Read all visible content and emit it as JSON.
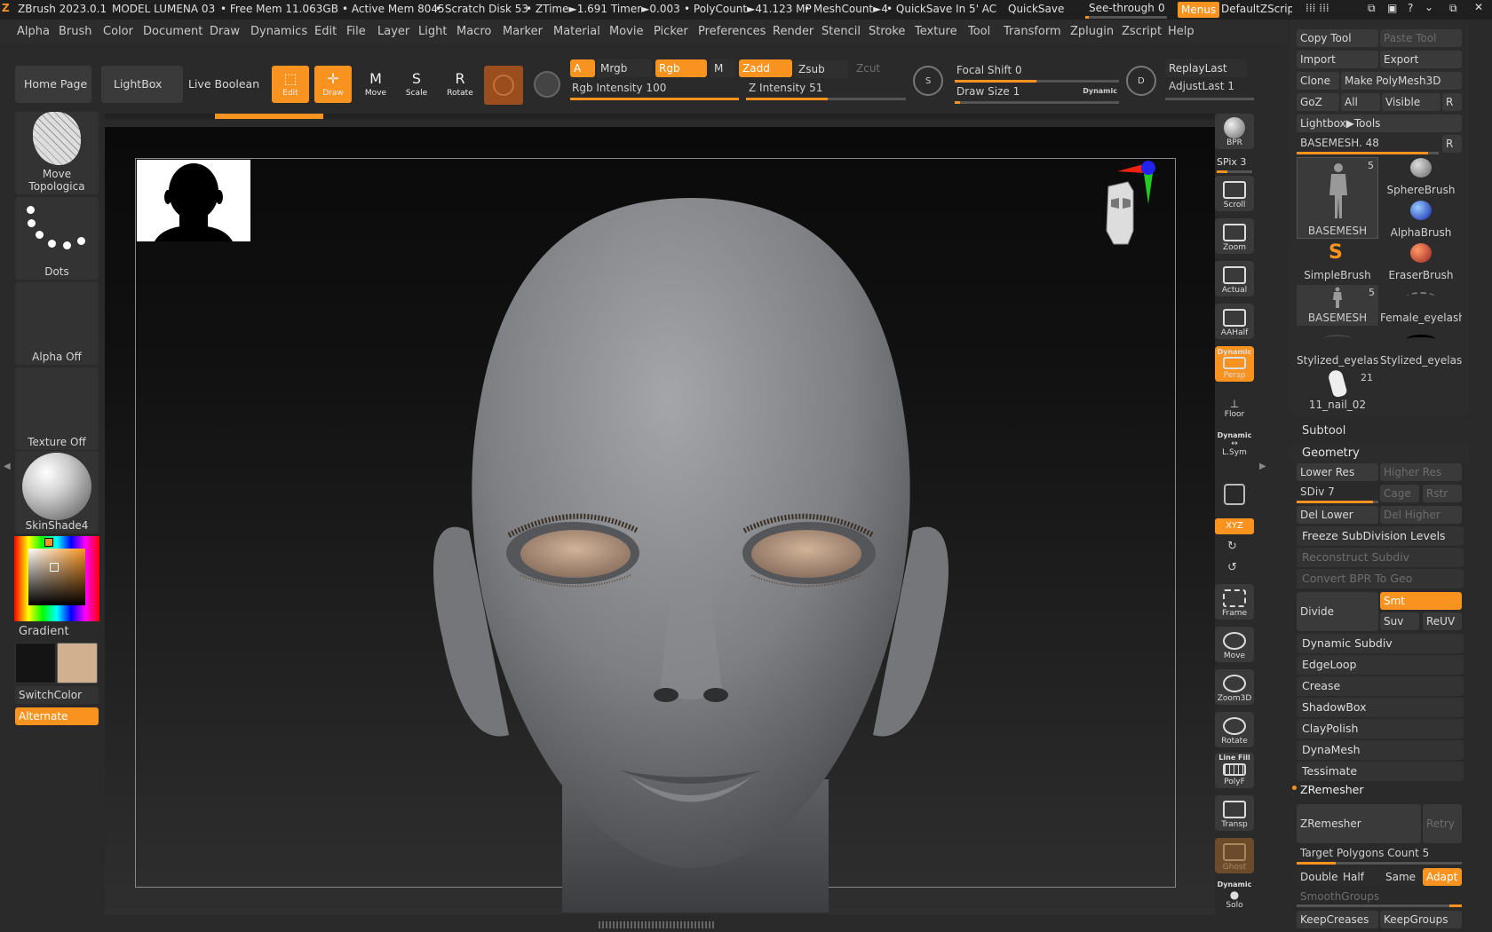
{
  "titlebar": {
    "app": "ZBrush 2023.0.1",
    "model": "MODEL LUMENA 03",
    "free_mem": "• Free Mem 11.063GB",
    "active_mem": "• Active Mem 8045",
    "scratch": "• Scratch Disk 53",
    "ztime": "• ZTime►1.691 Timer►0.003",
    "polycount": "• PolyCount►41.123 MP",
    "meshcount": "• MeshCount►4",
    "quicksave_in": "• QuickSave In 5' AC",
    "quicksave": "QuickSave",
    "seethrough": "See-through",
    "seethrough_val": "0",
    "menus": "Menus",
    "script": "DefaultZScript"
  },
  "menu": [
    "Alpha",
    "Brush",
    "Color",
    "Document",
    "Draw",
    "Dynamics",
    "Edit",
    "File",
    "Layer",
    "Light",
    "Macro",
    "Marker",
    "Material",
    "Movie",
    "Picker",
    "Preferences",
    "Render",
    "Stencil",
    "Stroke",
    "Texture",
    "Tool",
    "Transform",
    "Zplugin",
    "Zscript",
    "Help"
  ],
  "toolbar": {
    "home": "Home Page",
    "lightbox": "LightBox",
    "live_boolean": "Live Boolean",
    "edit": "Edit",
    "draw": "Draw",
    "move": "Move",
    "scale": "Scale",
    "rotate": "Rotate",
    "a": "A",
    "mrgb": "Mrgb",
    "rgb": "Rgb",
    "m": "M",
    "zadd": "Zadd",
    "zsub": "Zsub",
    "zcut": "Zcut",
    "rgb_intensity": "Rgb Intensity 100",
    "z_intensity": "Z Intensity 51",
    "focal_shift": "Focal Shift 0",
    "draw_size": "Draw Size 1",
    "dynamic": "Dynamic",
    "replay_last": "ReplayLast",
    "adjust_last": "AdjustLast 1",
    "rgb_intensity_val": 1.0,
    "z_intensity_val": 0.51
  },
  "left": {
    "brush": "Move Topologica",
    "stroke": "Dots",
    "alpha": "Alpha Off",
    "texture": "Texture Off",
    "material": "SkinShade4",
    "gradient": "Gradient",
    "switch_color": "SwitchColor",
    "alternate": "Alternate",
    "colors": {
      "primary": "#141414",
      "secondary": "#d0b08f",
      "accent": "#f7931e"
    }
  },
  "right_tools": {
    "bpr": "BPR",
    "spix": "SPix 3",
    "scroll": "Scroll",
    "zoom": "Zoom",
    "actual": "Actual",
    "aahalf": "AAHalf",
    "dynamic": "Dynamic",
    "persp": "Persp",
    "floor": "Floor",
    "lsym_dyn": "Dynamic",
    "lsym": "L.Sym",
    "xyz": "XYZ",
    "frame": "Frame",
    "move": "Move",
    "zoom3d": "Zoom3D",
    "rotate": "Rotate",
    "line_fill": "Line Fill",
    "polyf": "PolyF",
    "transp": "Transp",
    "ghost": "Ghost",
    "solo_dyn": "Dynamic",
    "solo": "Solo"
  },
  "tool_panel": {
    "copy_tool": "Copy Tool",
    "paste_tool": "Paste Tool",
    "import": "Import",
    "export": "Export",
    "clone": "Clone",
    "make_polymesh": "Make PolyMesh3D",
    "goz": "GoZ",
    "all": "All",
    "visible": "Visible",
    "r": "R",
    "lightbox_tools": "Lightbox▶Tools",
    "basemesh_slider": "BASEMESH. 48",
    "r2": "R",
    "thumbs": [
      {
        "label": "BASEMESH",
        "badge": "5"
      },
      {
        "label": "SphereBrush",
        "badge": ""
      },
      {
        "label": "AlphaBrush",
        "badge": ""
      },
      {
        "label": "SimpleBrush",
        "badge": ""
      },
      {
        "label": "EraserBrush",
        "badge": ""
      },
      {
        "label": "BASEMESH",
        "badge": "5"
      },
      {
        "label": "Female_eyelashe",
        "badge": ""
      },
      {
        "label": "Stylized_eyelash",
        "badge": ""
      },
      {
        "label": "Stylized_eyelash",
        "badge": ""
      },
      {
        "label": "11_nail_02",
        "badge": "21"
      }
    ]
  },
  "subtool": {
    "title": "Subtool",
    "geometry": "Geometry",
    "lower_res": "Lower Res",
    "higher_res": "Higher Res",
    "sdiv": "SDiv 7",
    "cage": "Cage",
    "rstr": "Rstr",
    "del_lower": "Del Lower",
    "del_higher": "Del Higher",
    "freeze": "Freeze SubDivision Levels",
    "reconstruct": "Reconstruct Subdiv",
    "convert_bpr": "Convert BPR To Geo",
    "divide": "Divide",
    "smt": "Smt",
    "suv": "Suv",
    "reuv": "ReUV",
    "dynamic_subdiv": "Dynamic Subdiv",
    "edgeloop": "EdgeLoop",
    "crease": "Crease",
    "shadowbox": "ShadowBox",
    "claypolish": "ClayPolish",
    "dynamesh": "DynaMesh",
    "tessimate": "Tessimate",
    "zremesher_header": "ZRemesher",
    "zremesher": "ZRemesher",
    "retry": "Retry",
    "target_poly": "Target Polygons Count 5",
    "double": "Double",
    "half": "Half",
    "same": "Same",
    "adapt": "Adapt",
    "smoothgroups": "SmoothGroups",
    "keepcreases": "KeepCreases",
    "keepgroups": "KeepGroups"
  }
}
